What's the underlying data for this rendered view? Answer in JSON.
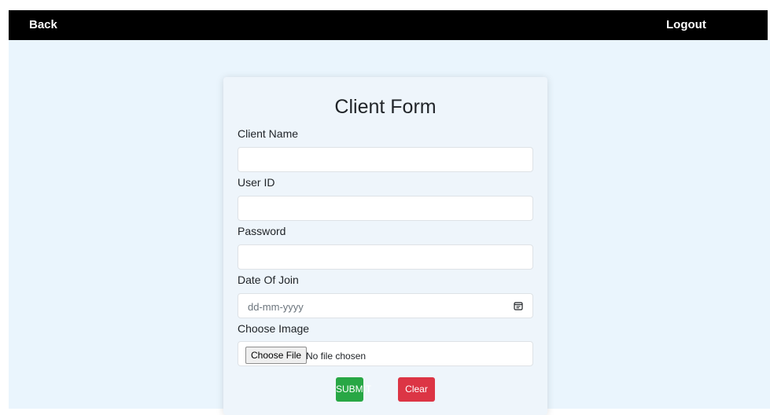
{
  "navbar": {
    "back_label": "Back",
    "logout_label": "Logout"
  },
  "form": {
    "title": "Client Form",
    "client_name": {
      "label": "Client Name",
      "value": ""
    },
    "user_id": {
      "label": "User ID",
      "value": ""
    },
    "password": {
      "label": "Password",
      "value": ""
    },
    "date_of_join": {
      "label": "Date Of Join",
      "placeholder": "dd-mm-yyyy"
    },
    "choose_image": {
      "label": "Choose Image",
      "button_label": "Choose File",
      "status": "No file chosen"
    },
    "submit_label": "SUBMIT",
    "clear_label": "Clear"
  },
  "colors": {
    "navbar_bg": "#000000",
    "page_bg": "#eaf5fd",
    "submit": "#28a745",
    "clear": "#dc3545"
  },
  "icons": {
    "date": "calendar-icon"
  }
}
